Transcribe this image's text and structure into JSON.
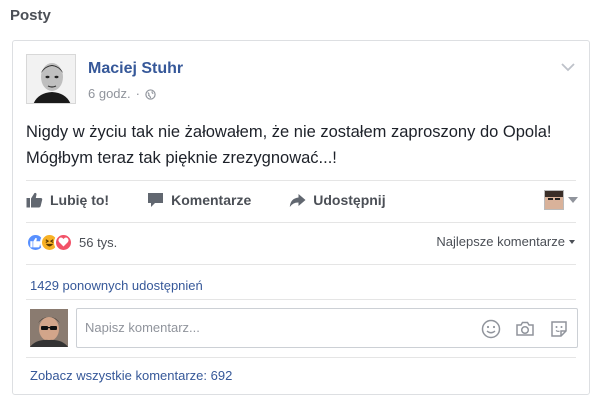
{
  "section": {
    "title": "Posty"
  },
  "post": {
    "author": "Maciej Stuhr",
    "time": "6 godz.",
    "separator": "·",
    "privacy_icon": "globe-icon",
    "text_lines": [
      "Nigdy w życiu tak nie żałowałem, że nie zostałem zaproszony do Opola!",
      "Mógłbym teraz tak pięknie zrezygnować...!"
    ]
  },
  "actions": {
    "like_label": "Lubię to!",
    "comment_label": "Komentarze",
    "share_label": "Udostępnij"
  },
  "reactions": {
    "types": [
      "like",
      "haha",
      "love"
    ],
    "count": "56 tys.",
    "sort_label": "Najlepsze komentarze"
  },
  "shares": {
    "label": "1429 ponownych udostępnień"
  },
  "comment_box": {
    "placeholder": "Napisz komentarz..."
  },
  "comments": {
    "see_all_label": "Zobacz wszystkie komentarze: 692"
  },
  "colors": {
    "link": "#365899",
    "like": "#5890ff",
    "haha": "#f7b125",
    "love": "#f25268"
  }
}
